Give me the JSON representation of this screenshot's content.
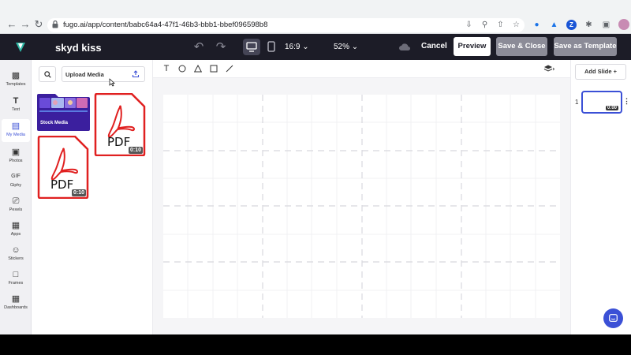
{
  "browser": {
    "url": "fugo.ai/app/content/babc64a4-47f1-46b3-bbb1-bbef096598b8"
  },
  "header": {
    "project_title": "skyd kiss",
    "aspect_ratio": "16:9",
    "zoom": "52%",
    "cancel_label": "Cancel",
    "preview_label": "Preview",
    "save_close_label": "Save & Close",
    "save_template_label": "Save as Template"
  },
  "sidebar": {
    "items": [
      {
        "label": "Templates",
        "icon": "templates-icon"
      },
      {
        "label": "Text",
        "icon": "text-icon"
      },
      {
        "label": "My Media",
        "icon": "my-media-icon",
        "active": true
      },
      {
        "label": "Photos",
        "icon": "photos-icon"
      },
      {
        "label": "Giphy",
        "icon": "giphy-icon"
      },
      {
        "label": "Pexels",
        "icon": "pexels-icon"
      },
      {
        "label": "Apps",
        "icon": "apps-icon"
      },
      {
        "label": "Stickers",
        "icon": "stickers-icon"
      },
      {
        "label": "Frames",
        "icon": "frames-icon"
      },
      {
        "label": "Dashboards",
        "icon": "dashboards-icon"
      }
    ]
  },
  "media": {
    "upload_label": "Upload Media",
    "stock_label": "Stock Media",
    "pdf_1": {
      "label": "PDF",
      "duration": "0:10"
    },
    "pdf_2": {
      "label": "PDF",
      "duration": "0:10"
    }
  },
  "slides": {
    "add_label": "Add Slide +",
    "items": [
      {
        "number": "1",
        "duration": "0:00"
      }
    ]
  },
  "colors": {
    "header_bg": "#1c1c27",
    "accent": "#3b50d6",
    "pdf_red": "#e02020"
  }
}
